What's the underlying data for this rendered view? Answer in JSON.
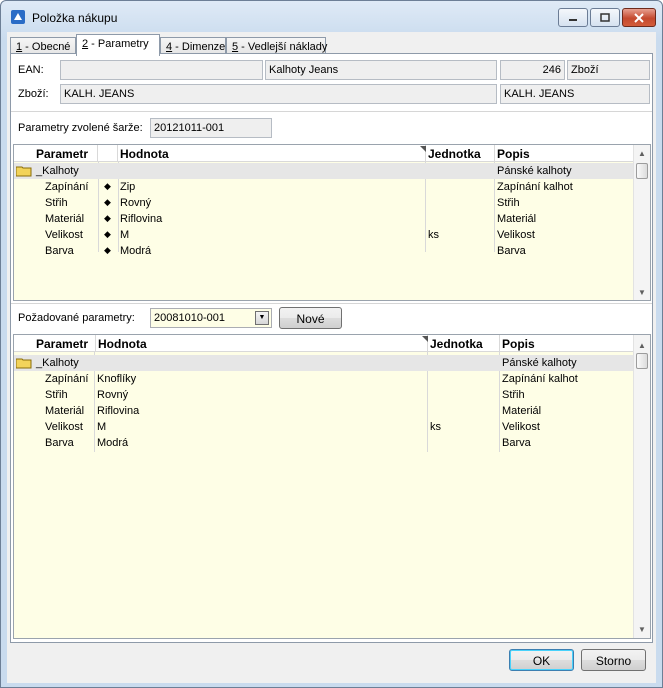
{
  "window": {
    "title": "Položka nákupu"
  },
  "tabs": [
    {
      "key": "1",
      "label": " - Obecné"
    },
    {
      "key": "2",
      "label": " - Parametry"
    },
    {
      "key": "4",
      "label": " - Dimenze"
    },
    {
      "key": "5",
      "label": " - Vedlejší náklady"
    }
  ],
  "header": {
    "ean_label": "EAN:",
    "ean_value": "",
    "product_name": "Kalhoty Jeans",
    "product_number": "246",
    "product_type": "Zboží",
    "goods_label": "Zboží:",
    "goods_code": "KALH. JEANS",
    "goods_code_right": "KALH. JEANS"
  },
  "batch": {
    "label": "Parametry zvolené šarže:",
    "value": "20121011-001"
  },
  "grid_top": {
    "columns": [
      "Parametr",
      "Hodnota",
      "Jednotka",
      "Popis"
    ],
    "rows": [
      {
        "param": "_Kalhoty",
        "marker": "",
        "value": "",
        "unit": "",
        "desc": "Pánské kalhoty",
        "group": true
      },
      {
        "param": "Zapínání",
        "marker": "◆",
        "value": "Zip",
        "unit": "",
        "desc": "Zapínání kalhot"
      },
      {
        "param": "Střih",
        "marker": "◆",
        "value": "Rovný",
        "unit": "",
        "desc": "Střih"
      },
      {
        "param": "Materiál",
        "marker": "◆",
        "value": "Riflovina",
        "unit": "",
        "desc": "Materiál"
      },
      {
        "param": "Velikost",
        "marker": "◆",
        "value": "M",
        "unit": "ks",
        "desc": "Velikost"
      },
      {
        "param": "Barva",
        "marker": "◆",
        "value": "Modrá",
        "unit": "",
        "desc": "Barva"
      }
    ]
  },
  "required": {
    "label": "Požadované parametry:",
    "value": "20081010-001",
    "new_button": "Nové"
  },
  "grid_bottom": {
    "columns": [
      "Parametr",
      "Hodnota",
      "Jednotka",
      "Popis"
    ],
    "rows": [
      {
        "param": "_Kalhoty",
        "value": "",
        "unit": "",
        "desc": "Pánské kalhoty",
        "group": true
      },
      {
        "param": "Zapínání",
        "value": "Knoflíky",
        "unit": "",
        "desc": "Zapínání kalhot"
      },
      {
        "param": "Střih",
        "value": "Rovný",
        "unit": "",
        "desc": "Střih"
      },
      {
        "param": "Materiál",
        "value": "Riflovina",
        "unit": "",
        "desc": "Materiál"
      },
      {
        "param": "Velikost",
        "value": "M",
        "unit": "ks",
        "desc": "Velikost"
      },
      {
        "param": "Barva",
        "value": "Modrá",
        "unit": "",
        "desc": "Barva"
      }
    ]
  },
  "footer": {
    "ok": "OK",
    "cancel": "Storno"
  },
  "icons": {
    "scroll_up": "▲",
    "scroll_down": "▼",
    "combo_arrow": "▼"
  }
}
